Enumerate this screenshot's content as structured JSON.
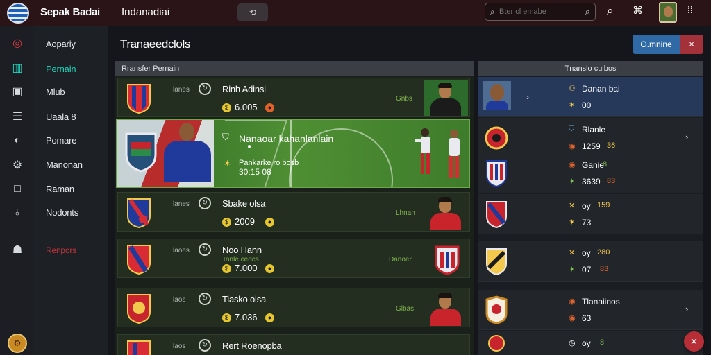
{
  "topbar": {
    "app_title": "Sepak Badai",
    "app_subtitle": "Indanadiai",
    "toolbar_button": "⟲",
    "search_placeholder": "Bter cl emabe",
    "icons": [
      "search-icon",
      "qr-icon",
      "avatar",
      "grid-icon"
    ]
  },
  "sidebar": {
    "icons": [
      "target-icon",
      "building-icon",
      "camera-icon",
      "list-icon",
      "compass-icon",
      "gear-icon",
      "square-icon",
      "whistle-icon",
      "bell-icon"
    ],
    "items": [
      {
        "label": "Aopariy",
        "active": false
      },
      {
        "label": "Pernain",
        "active": true
      },
      {
        "label": "Mlub",
        "active": false
      },
      {
        "label": "Uaala 8",
        "active": false
      },
      {
        "label": "Pomare",
        "active": false
      },
      {
        "label": "Manonan",
        "active": false
      },
      {
        "label": "Raman",
        "active": false
      },
      {
        "label": "Nodonts",
        "active": false
      }
    ],
    "report_label": "Renpors"
  },
  "main": {
    "title": "Tranaeedclols",
    "primary_button": "O.mnine",
    "close_button": "×",
    "list_header": "Rransfer Pernain",
    "rows": [
      {
        "tag": "lanes",
        "name": "Rinh Adinsl",
        "sub": "",
        "value": "6.005",
        "meta": "Gnbs",
        "player": true
      },
      {
        "tag": "lanes",
        "name": "Sbake olsa",
        "sub": "",
        "value": "2009",
        "meta": "Lhnan",
        "player": true
      },
      {
        "tag": "laoes",
        "name": "Noo Hann",
        "sub": "Tonle cedcs",
        "value": "7.000",
        "meta": "Danoer",
        "player": false
      },
      {
        "tag": "laos",
        "name": "Tiasko olsa",
        "sub": "",
        "value": "7.036",
        "meta": "Glbas",
        "player": true
      },
      {
        "tag": "laos",
        "name": "Rert Roenopba",
        "sub": "",
        "value": "",
        "meta": "",
        "player": false
      }
    ],
    "feature": {
      "title": "Nanaoar kahanlanlain",
      "subtitle": "Pankarke ro bosb",
      "value": "30:15 08"
    }
  },
  "right_panel": {
    "header": "Tnanslo cuibos",
    "rows": [
      {
        "line1": "Danan bai",
        "line2": "00",
        "mark": "›",
        "chev": false,
        "selected": true
      },
      {
        "line1": "Rlanle",
        "line2": "1259",
        "line1_extra": "",
        "line2_extra": "36",
        "mark": "",
        "chev": true,
        "selected": false
      },
      {
        "line1": "Ganie",
        "line2": "3639",
        "line1_extra": "8",
        "line2_extra": "83",
        "mark": "",
        "chev": false,
        "selected": false
      },
      {
        "line1": "oy",
        "line2": "73",
        "line1_extra": "159",
        "line2_extra": "",
        "mark": "",
        "chev": false,
        "selected": false
      },
      {
        "line1": "oy",
        "line2": "07",
        "line1_extra": "280",
        "line2_extra": "83",
        "mark": "",
        "chev": false,
        "selected": false
      },
      {
        "line1": "Tlanaiinos",
        "line2": "63",
        "line1_extra": "",
        "line2_extra": "",
        "mark": "",
        "chev": true,
        "selected": false
      },
      {
        "line1": "oy",
        "line2": "",
        "line1_extra": "8",
        "line2_extra": "",
        "mark": "",
        "chev": false,
        "selected": false
      }
    ]
  },
  "fab_label": "✕"
}
